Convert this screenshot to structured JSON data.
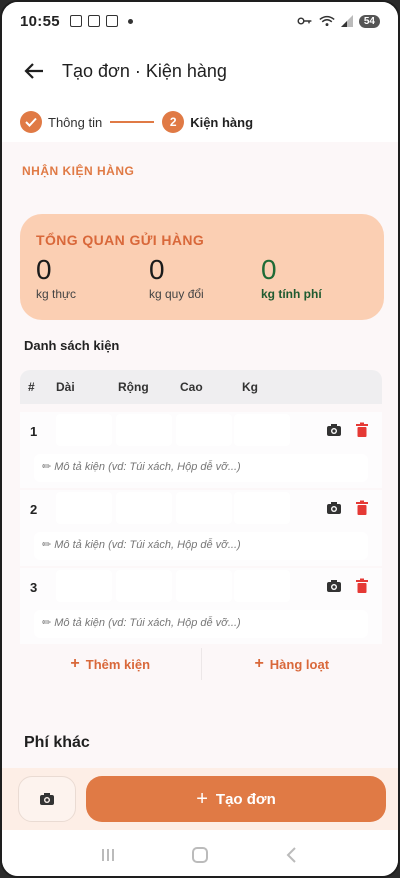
{
  "status": {
    "time": "10:55",
    "battery": "54"
  },
  "header": {
    "title": "Tạo đơn · Kiện hàng"
  },
  "stepper": {
    "step1": {
      "label": "Thông tin",
      "icon": "check-icon"
    },
    "step2": {
      "number": "2",
      "label": "Kiện hàng"
    }
  },
  "section": {
    "title": "NHẬN KIỆN HÀNG"
  },
  "overview": {
    "title": "TỔNG QUAN GỬI HÀNG",
    "actual": {
      "value": "0",
      "label": "kg thực"
    },
    "converted": {
      "value": "0",
      "label": "kg quy đổi"
    },
    "charged": {
      "value": "0",
      "label": "kg tính phí"
    }
  },
  "list": {
    "title": "Danh sách kiện",
    "headers": [
      "#",
      "Dài",
      "Rộng",
      "Cao",
      "Kg"
    ],
    "rows": [
      {
        "index": "1",
        "desc_placeholder": "Mô tả kiện (vd: Túi xách, Hộp dễ vỡ...)"
      },
      {
        "index": "2",
        "desc_placeholder": "Mô tả kiện (vd: Túi xách, Hộp dễ vỡ...)"
      },
      {
        "index": "3",
        "desc_placeholder": "Mô tả kiện (vd: Túi xách, Hộp dễ vỡ...)"
      }
    ]
  },
  "actions": {
    "add_item": "Thêm kiện",
    "bulk": "Hàng loạt"
  },
  "other_fee": {
    "title": "Phí khác"
  },
  "bottom": {
    "create": "Tạo đơn"
  },
  "colors": {
    "accent": "#e07a45",
    "overview_bg": "#fbcfb3",
    "charged": "#1f6b36",
    "delete": "#e53935"
  }
}
